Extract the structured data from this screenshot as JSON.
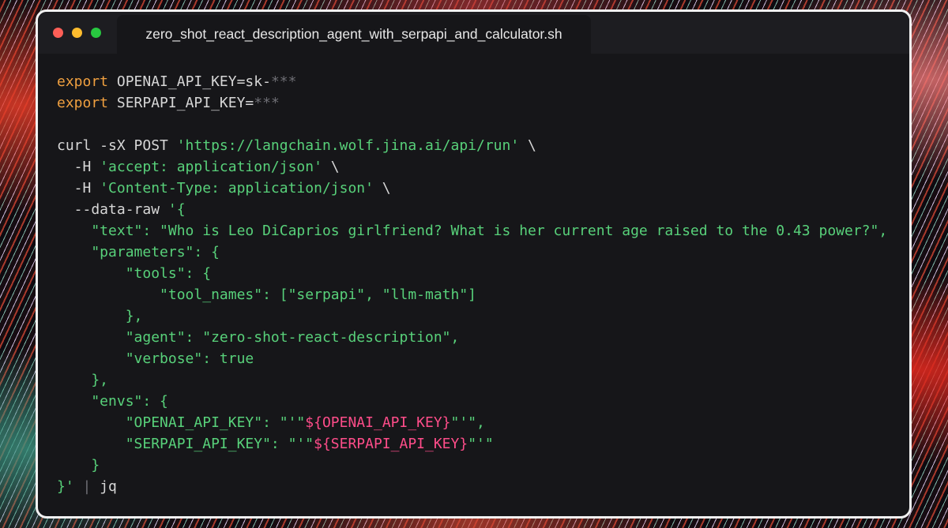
{
  "window": {
    "tab_title": "zero_shot_react_description_agent_with_serpapi_and_calculator.sh",
    "traffic_lights": [
      "close",
      "minimize",
      "maximize"
    ]
  },
  "code": {
    "export_keyword": "export",
    "line1_name": " OPENAI_API_KEY=sk-",
    "line1_masked": "***",
    "line2_name": " SERPAPI_API_KEY=",
    "line2_masked": "***",
    "curl_cmd": "curl -sX POST ",
    "url": "'https://langchain.wolf.jina.ai/api/run'",
    "line_cont": " \\",
    "h_flag": "  -H ",
    "h1": "'accept: application/json'",
    "h2": "'Content-Type: application/json'",
    "data_flag": "  --data-raw ",
    "json_open": "'{",
    "text_line": "    \"text\": \"Who is Leo DiCaprios girlfriend? What is her current age raised to the 0.43 power?\",",
    "params_open": "    \"parameters\": {",
    "tools_open": "        \"tools\": {",
    "tool_names": "            \"tool_names\": [\"serpapi\", \"llm-math\"]",
    "tools_close": "        },",
    "agent": "        \"agent\": \"zero-shot-react-description\",",
    "verbose": "        \"verbose\": true",
    "params_close": "    },",
    "envs_open": "    \"envs\": {",
    "env1_key": "        \"OPENAI_API_KEY\": \"'\"",
    "env1_var": "${OPENAI_API_KEY}",
    "env1_end": "\"'\",",
    "env2_key": "        \"SERPAPI_API_KEY\": \"'\"",
    "env2_var": "${SERPAPI_API_KEY}",
    "env2_end": "\"'\"",
    "envs_close": "    }",
    "json_close": "}'",
    "pipe": "|",
    "jq": "jq"
  },
  "colors": {
    "keyword": "#f0a040",
    "string": "#58d17a",
    "variable": "#ff4d8a",
    "background": "#161619"
  }
}
